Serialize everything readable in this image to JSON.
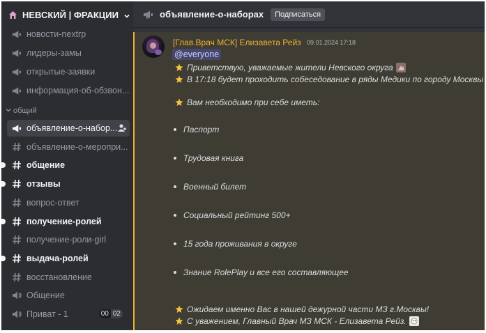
{
  "server": {
    "name": "НЕВСКИЙ | ФРАКЦИИ"
  },
  "sidebar": {
    "channels_top": [
      {
        "label": "новости-nextrp",
        "icon": "announcement-icon",
        "state": "normal"
      },
      {
        "label": "лидеры-замы",
        "icon": "announcement-icon",
        "state": "normal"
      },
      {
        "label": "открытые-заявки",
        "icon": "announcement-icon",
        "state": "normal"
      },
      {
        "label": "информация-об-обзвон...",
        "icon": "announcement-icon",
        "state": "normal"
      }
    ],
    "category": "общий",
    "channels": [
      {
        "label": "объявление-о-набор...",
        "icon": "announcement-icon",
        "state": "active"
      },
      {
        "label": "объявление-о-меропри...",
        "icon": "hash-icon",
        "state": "normal"
      },
      {
        "label": "общение",
        "icon": "hash-icon",
        "state": "unread"
      },
      {
        "label": "отзывы",
        "icon": "hash-icon",
        "state": "unread"
      },
      {
        "label": "вопрос-ответ",
        "icon": "hash-icon",
        "state": "normal"
      },
      {
        "label": "получение-ролей",
        "icon": "hash-icon",
        "state": "unread"
      },
      {
        "label": "получение-роли-girl",
        "icon": "hash-icon",
        "state": "normal"
      },
      {
        "label": "выдача-ролей",
        "icon": "hash-icon",
        "state": "unread"
      },
      {
        "label": "восстановление",
        "icon": "hash-icon",
        "state": "normal"
      },
      {
        "label": "Общение",
        "icon": "speaker-icon",
        "state": "normal"
      },
      {
        "label": "Приват - 1",
        "icon": "speaker-icon",
        "state": "normal",
        "count_a": "00",
        "count_b": "02"
      }
    ]
  },
  "header": {
    "channel_name": "объявление-о-наборах",
    "subscribe_label": "Подписаться"
  },
  "message": {
    "author": "[Глав.Врач МСК] Елизавета Рейз",
    "timestamp": "09.01.2024 17:18",
    "mention": "@everyone",
    "line1": "Приветствую, уважаемые жители Невского округа",
    "line2": "В 17:18 будет проходить собеседование в ряды Медики  по городу Москвы",
    "line3": "Вам необходимо при себе иметь:",
    "bullets": [
      "Паспорт",
      "Трудовая книга",
      "Военный билет",
      "Социальный рейтинг 500+",
      "15 года проживания в округе",
      "Знание RolePlay и все его составляющее"
    ],
    "line4": "Ожидаем именно Вас в нашей дежурной части МЗ  г.Москвы!",
    "line5": "С уважением, Главный Врач МЗ МСК - Елизавета Рейз."
  },
  "colors": {
    "sidebar_bg": "#2b2d31",
    "main_bg": "#313338",
    "highlight_bg": "#3e3c33",
    "highlight_border": "#f0b232",
    "author": "#f0b232"
  }
}
